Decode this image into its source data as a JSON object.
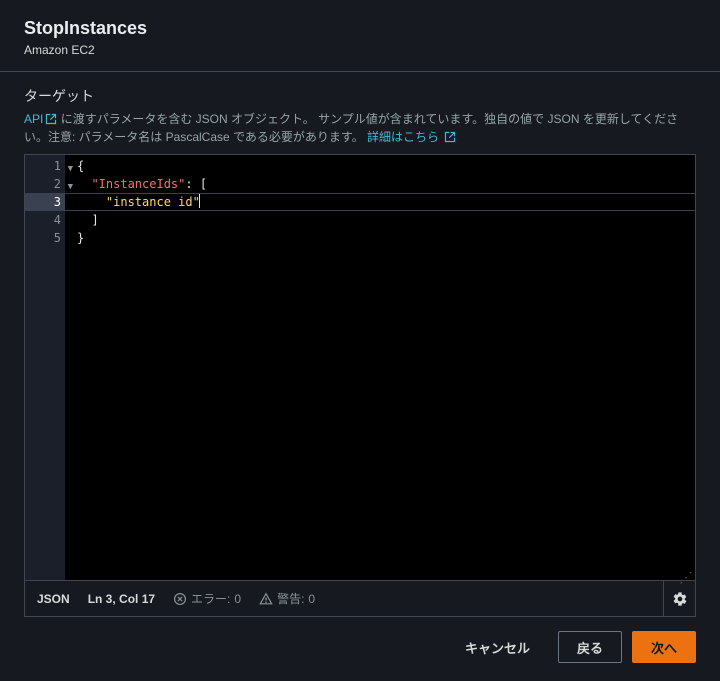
{
  "header": {
    "title": "StopInstances",
    "subtitle": "Amazon EC2"
  },
  "field": {
    "label": "ターゲット",
    "help_before": "API",
    "help_after": " に渡すパラメータを含む JSON オブジェクト。 サンプル値が含まれています。独自の値で JSON を更新してください。注意: パラメータ名は PascalCase である必要があります。 ",
    "help_link": "詳細はこちら"
  },
  "editor": {
    "lines": [
      {
        "n": "1",
        "fold": true,
        "active": false,
        "segments": [
          {
            "t": "{",
            "c": "tok-pun"
          }
        ]
      },
      {
        "n": "2",
        "fold": true,
        "active": false,
        "segments": [
          {
            "t": "  ",
            "c": ""
          },
          {
            "t": "\"InstanceIds\"",
            "c": "tok-key"
          },
          {
            "t": ": [",
            "c": "tok-pun"
          }
        ]
      },
      {
        "n": "3",
        "fold": false,
        "active": true,
        "segments": [
          {
            "t": "    ",
            "c": ""
          },
          {
            "t": "\"instance id\"",
            "c": "tok-str"
          }
        ],
        "cursor": true
      },
      {
        "n": "4",
        "fold": false,
        "active": false,
        "segments": [
          {
            "t": "  ]",
            "c": "tok-pun"
          }
        ]
      },
      {
        "n": "5",
        "fold": false,
        "active": false,
        "segments": [
          {
            "t": "}",
            "c": "tok-pun"
          }
        ]
      }
    ]
  },
  "status": {
    "lang": "JSON",
    "position": "Ln 3, Col 17",
    "errors_label": "エラー: ",
    "errors": "0",
    "warnings_label": "警告: ",
    "warnings": "0"
  },
  "footer": {
    "cancel": "キャンセル",
    "back": "戻る",
    "next": "次へ"
  }
}
